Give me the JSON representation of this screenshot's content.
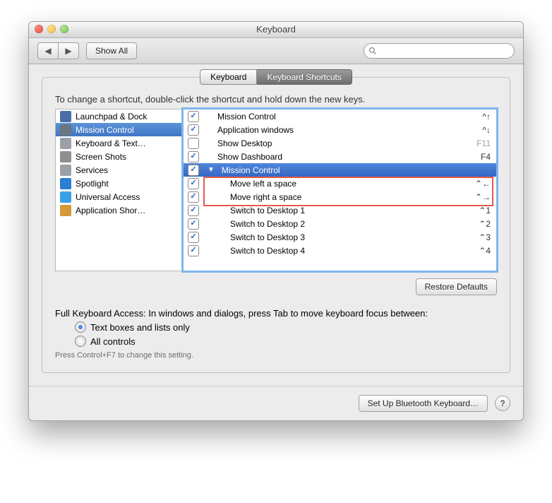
{
  "window": {
    "title": "Keyboard"
  },
  "toolbar": {
    "back_label": "◀",
    "forward_label": "▶",
    "show_all_label": "Show All",
    "search_placeholder": ""
  },
  "tabs": {
    "items": [
      "Keyboard",
      "Keyboard Shortcuts"
    ],
    "active": 1
  },
  "instruction": "To change a shortcut, double-click the shortcut and hold down the new keys.",
  "categories": [
    {
      "label": "Launchpad & Dock",
      "icon": "launchpad"
    },
    {
      "label": "Mission Control",
      "icon": "mission"
    },
    {
      "label": "Keyboard & Text…",
      "icon": "keyboard"
    },
    {
      "label": "Screen Shots",
      "icon": "screenshot"
    },
    {
      "label": "Services",
      "icon": "services"
    },
    {
      "label": "Spotlight",
      "icon": "spotlight"
    },
    {
      "label": "Universal Access",
      "icon": "universal"
    },
    {
      "label": "Application Shor…",
      "icon": "appshort"
    }
  ],
  "category_selected": 1,
  "shortcuts": [
    {
      "checked": true,
      "label": "Mission Control",
      "key": "^↑",
      "indent": 0,
      "enabled": true
    },
    {
      "checked": true,
      "label": "Application windows",
      "key": "^↓",
      "indent": 0,
      "enabled": true
    },
    {
      "checked": false,
      "label": "Show Desktop",
      "key": "F11",
      "indent": 0,
      "enabled": false
    },
    {
      "checked": true,
      "label": "Show Dashboard",
      "key": "F4",
      "indent": 0,
      "enabled": true
    },
    {
      "group_header": true,
      "checked": true,
      "label": "Mission Control"
    },
    {
      "checked": true,
      "label": "Move left a space",
      "key": "⌃←",
      "indent": 1,
      "enabled": true,
      "highlight": true
    },
    {
      "checked": true,
      "label": "Move right a space",
      "key": "⌃→",
      "indent": 1,
      "enabled": true,
      "highlight": true
    },
    {
      "checked": true,
      "label": "Switch to Desktop 1",
      "key": "⌃1",
      "indent": 1,
      "enabled": true
    },
    {
      "checked": true,
      "label": "Switch to Desktop 2",
      "key": "⌃2",
      "indent": 1,
      "enabled": true
    },
    {
      "checked": true,
      "label": "Switch to Desktop 3",
      "key": "⌃3",
      "indent": 1,
      "enabled": true
    },
    {
      "checked": true,
      "label": "Switch to Desktop 4",
      "key": "⌃4",
      "indent": 1,
      "enabled": true
    }
  ],
  "restore_label": "Restore Defaults",
  "fka": {
    "text": "Full Keyboard Access: In windows and dialogs, press Tab to move keyboard focus between:",
    "opt1": "Text boxes and lists only",
    "opt2": "All controls",
    "selected": 0,
    "hint": "Press Control+F7 to change this setting."
  },
  "footer": {
    "bt_label": "Set Up Bluetooth Keyboard…",
    "help": "?"
  },
  "icon_colors": {
    "launchpad": "#4a6fa5",
    "mission": "#6b7580",
    "keyboard": "#9aa0a6",
    "screenshot": "#8f8f8f",
    "services": "#9aa0a6",
    "spotlight": "#2a7fd4",
    "universal": "#3aa0e8",
    "appshort": "#d49a3a"
  }
}
